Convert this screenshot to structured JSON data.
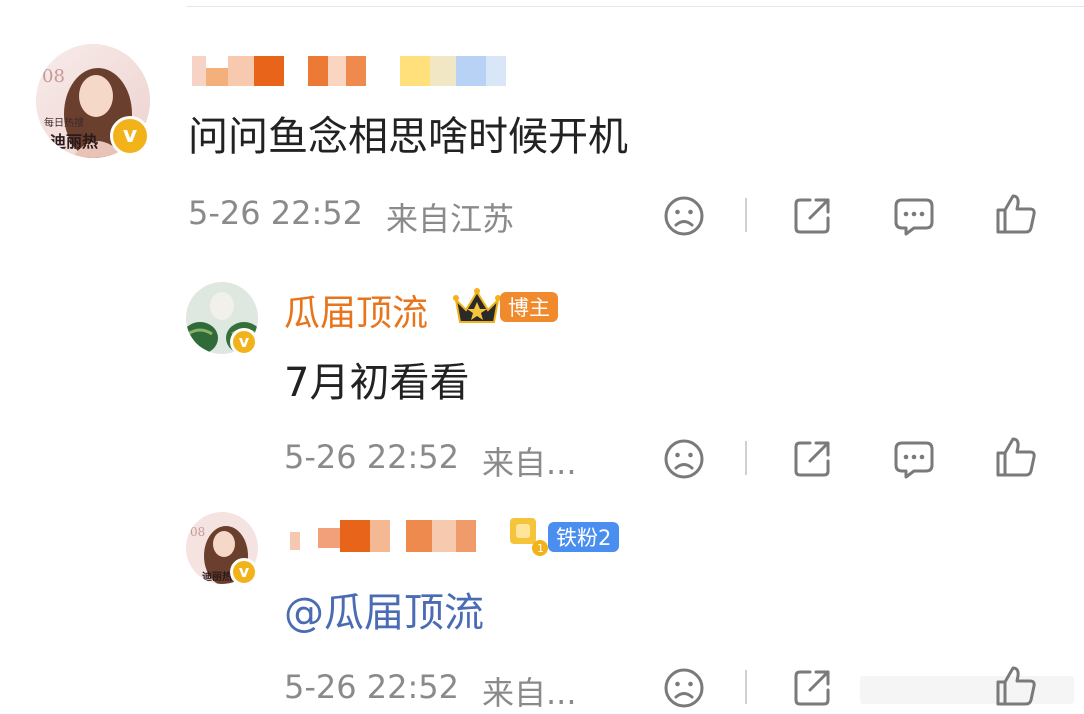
{
  "comment": {
    "text": "问问鱼念相思啥时候开机",
    "time": "5-26 22:52",
    "location": "来自江苏"
  },
  "reply1": {
    "username": "瓜届顶流",
    "badge": "博主",
    "text": "7月初看看",
    "time": "5-26 22:52",
    "location": "来自..."
  },
  "reply2": {
    "badge": "铁粉2",
    "text": "@瓜届顶流",
    "time": "5-26 22:52",
    "location": "来自..."
  },
  "avatar_text": {
    "line1": "每日热搜",
    "line2": "迪丽热",
    "year": "08"
  },
  "icons": [
    "sad-face-icon",
    "share-icon",
    "comment-icon",
    "like-icon"
  ],
  "colors": {
    "name_orange": "#e8741c",
    "mention_blue": "#4a6cb4",
    "verified_gold": "#f2b21a",
    "badge_orange": "#f08a2c",
    "badge_blue": "#4a8ff0",
    "meta_gray": "#8a8a8a"
  }
}
